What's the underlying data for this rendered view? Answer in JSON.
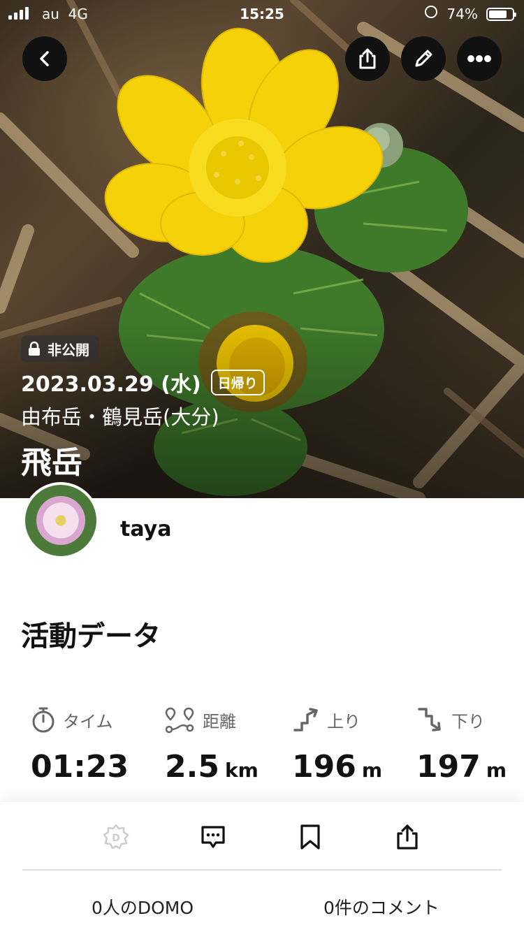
{
  "status_bar": {
    "carrier": "au",
    "network": "4G",
    "time": "15:25",
    "battery": "74%"
  },
  "hero": {
    "privacy_label": "非公開",
    "date": "2023.03.29 (水)",
    "trip_type": "日帰り",
    "area": "由布岳・鶴見岳(大分)",
    "mountain": "飛岳"
  },
  "user": {
    "name": "taya"
  },
  "activity": {
    "section_title": "活動データ",
    "stats": [
      {
        "label": "タイム",
        "value": "01:23",
        "unit": ""
      },
      {
        "label": "距離",
        "value": "2.5",
        "unit": "km"
      },
      {
        "label": "上り",
        "value": "196",
        "unit": "m"
      },
      {
        "label": "下り",
        "value": "197",
        "unit": "m"
      }
    ]
  },
  "footer": {
    "domo_count": "0人のDOMO",
    "comment_count": "0件のコメント"
  },
  "icons": {
    "back": "chevron-left-icon",
    "share": "share-icon",
    "edit": "pencil-icon",
    "more": "ellipsis-icon",
    "lock": "lock-icon",
    "timer": "stopwatch-icon",
    "distance": "route-icon",
    "up": "ascent-icon",
    "down": "descent-icon",
    "domo": "domo-icon",
    "comment": "comment-icon",
    "bookmark": "bookmark-icon",
    "share2": "share-icon"
  },
  "colors": {
    "accent_dark": "#111111",
    "muted": "#666666",
    "flower": "#f5d10a"
  }
}
